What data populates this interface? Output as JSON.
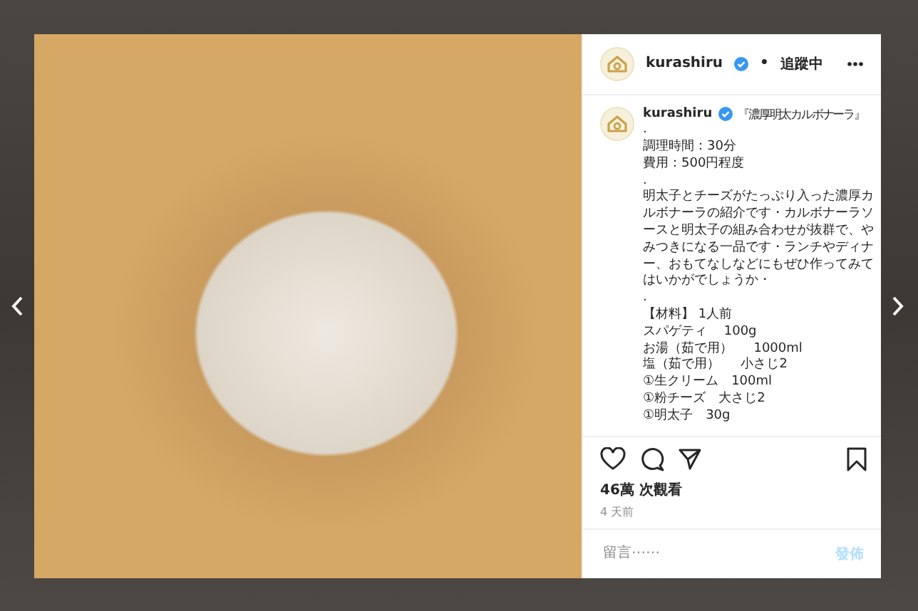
{
  "header": {
    "username": "kurashiru",
    "verified": true,
    "separator": "•",
    "follow_status": "追蹤中"
  },
  "caption": {
    "username": "kurashiru",
    "verified": true,
    "title": "『濃厚明太カルボナーラ』",
    "lines": [
      ".",
      "調理時間：30分",
      "費用：500円程度",
      ".",
      "明太子とチーズがたっぷり入った濃厚カルボナーラの紹介です・カルボナーラソースと明太子の組み合わせが抜群で、やみつきになる一品です・ランチやディナー、おもてなしなどにもぜひ作ってみてはいかがでしょうか・",
      ".",
      "【材料】 1人前",
      "スパゲティ　 100g",
      "お湯（茹で用）　  1000ml",
      "塩（茹で用）　  小さじ2",
      "①生クリーム　100ml",
      "①粉チーズ　大さじ2",
      "①明太子　30g"
    ]
  },
  "views": "46萬 次觀看",
  "time": "4 天前",
  "comment": {
    "placeholder": "留言⋯⋯",
    "post_button": "發佈",
    "disabled": true
  }
}
